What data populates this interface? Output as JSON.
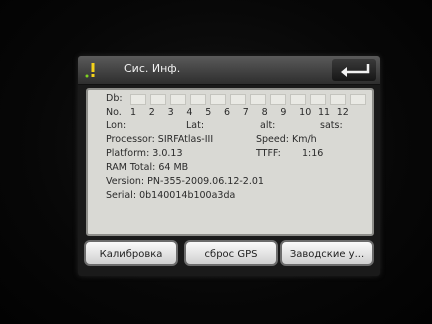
{
  "header": {
    "title": "Сис. Инф.",
    "back_icon": "back-arrow-icon",
    "info_icon": "warning-exclamation-icon"
  },
  "info": {
    "db_label": "Db:",
    "no_label": "No.",
    "satellite_numbers": [
      "1",
      "2",
      "3",
      "4",
      "5",
      "6",
      "7",
      "8",
      "9",
      "10",
      "11",
      "12"
    ],
    "lon_label": "Lon:",
    "lat_label": "Lat:",
    "alt_label": "alt:",
    "sats_label": "sats:",
    "processor_label": "Processor: SIRFAtlas-III",
    "speed_label": "Speed: Km/h",
    "platform_label": "Platform: 3.0.13",
    "ttff_label": "TTFF:",
    "ttff_value": "1:16",
    "ram_label": "RAM Total: 64 MB",
    "version_label": "Version: PN-355-2009.06.12-2.01",
    "serial_label": "Serial: 0b140014b100a3da"
  },
  "buttons": {
    "calibrate": "Калибровка",
    "reset_gps": "сброс GPS",
    "factory": "Заводские у..."
  },
  "colors": {
    "panel_bg": "#d9d9d4",
    "header_bg": "#3c3c3c",
    "button_bg": "#e6e6e6",
    "screen_bg": "#1a1a1a"
  }
}
